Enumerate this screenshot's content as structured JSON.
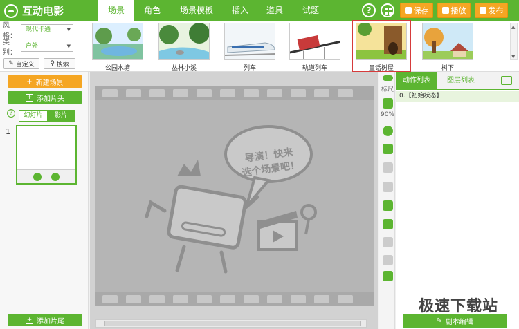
{
  "app": {
    "title": "互动电影"
  },
  "tabs": [
    "场景",
    "角色",
    "场景模板",
    "插入",
    "道具",
    "试题"
  ],
  "toolbar": {
    "help": "?",
    "save": "保存",
    "play": "播放",
    "publish": "发布"
  },
  "filters": {
    "style_label": "风格：",
    "style_value": "现代卡通",
    "category_label": "类别：",
    "category_value": "户外",
    "custom_label": "自定义",
    "search_label": "搜索"
  },
  "scenes": [
    {
      "label": "公园水塘"
    },
    {
      "label": "丛林小溪"
    },
    {
      "label": "列车"
    },
    {
      "label": "轨道列车"
    },
    {
      "label": "童话树屋"
    },
    {
      "label": "树下"
    }
  ],
  "left": {
    "new_scene": "新建场景",
    "add_head": "添加片头",
    "mode_slide": "幻灯片",
    "mode_film": "影片",
    "scene_number": "1",
    "add_tail": "添加片尾",
    "help": "?"
  },
  "stage": {
    "hint_line1": "导演！快来",
    "hint_line2": "选个场景吧！"
  },
  "side_tools": {
    "ruler": "标尺",
    "zoom": "90%"
  },
  "right": {
    "tab_actions": "动作列表",
    "tab_layers": "图层列表",
    "action_item": "0.【初始状态】",
    "script_edit": "剧本编辑"
  },
  "watermark": "极速下载站",
  "colors": {
    "brand_green": "#5cb531",
    "accent_orange": "#f5a623",
    "selection_red": "#d63b3b"
  }
}
